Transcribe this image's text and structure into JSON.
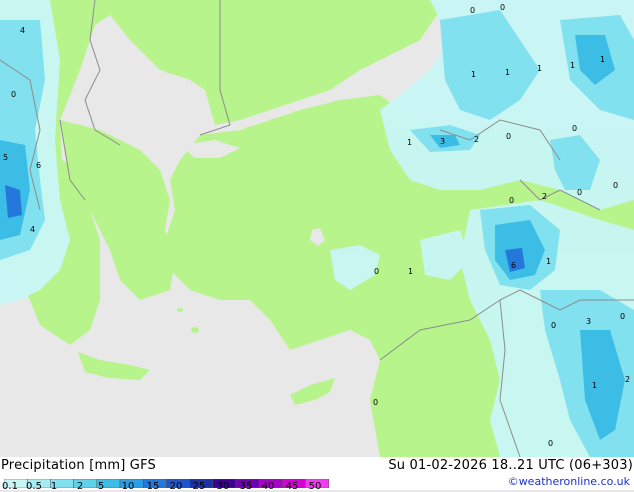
{
  "product": {
    "title": "Precipitation [mm]  GFS",
    "datetime": "Su 01-02-2026 18..21 UTC (06+303)",
    "credit": "©weatheronline.co.uk"
  },
  "legend": {
    "labels": [
      "0.1",
      "0.5",
      "1",
      "2",
      "5",
      "10",
      "15",
      "20",
      "25",
      "30",
      "35",
      "40",
      "45",
      "50"
    ],
    "colors": [
      "#c8f5f5",
      "#a5ecf2",
      "#82e1ee",
      "#5fd1ea",
      "#3cbde6",
      "#2a9ee6",
      "#2478dc",
      "#1f56cc",
      "#1a32a8",
      "#3c0096",
      "#7000b4",
      "#a800c8",
      "#d400d4",
      "#f03cf0"
    ]
  },
  "colors": {
    "land": "#b7f58c",
    "sea": "#e8e8e8",
    "border": "#8c8c8c",
    "light_precip": "#c8f5f5",
    "medium_precip": "#82e1ee",
    "heavy_precip": "#3cbde6",
    "very_heavy_precip": "#2478dc"
  },
  "map_labels": [
    "4",
    "0",
    "5",
    "6",
    "4",
    "0",
    "0",
    "1",
    "1",
    "1",
    "1",
    "1",
    "3",
    "2",
    "0",
    "0",
    "1",
    "0",
    "2",
    "0",
    "0",
    "1",
    "6",
    "1",
    "0",
    "3",
    "0",
    "1",
    "2",
    "0",
    "0",
    "0"
  ]
}
